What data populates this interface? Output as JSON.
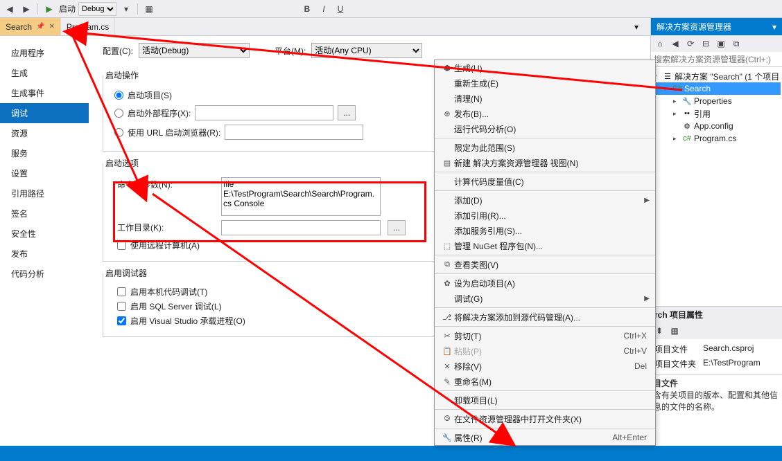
{
  "toolbar": {
    "start_label": "启动",
    "debug_label": "Debug"
  },
  "tabs": {
    "t0": "Search",
    "t1": "Program.cs"
  },
  "side": {
    "items": [
      "应用程序",
      "生成",
      "生成事件",
      "调试",
      "资源",
      "服务",
      "设置",
      "引用路径",
      "签名",
      "安全性",
      "发布",
      "代码分析"
    ],
    "active_index": 3
  },
  "config": {
    "cfg_label": "配置(C):",
    "cfg_val": "活动(Debug)",
    "plat_label": "平台(M):",
    "plat_val": "活动(Any CPU)"
  },
  "section1": {
    "title": "启动操作",
    "r0": "启动项目(S)",
    "r1": "启动外部程序(X):",
    "r2": "使用 URL 启动浏览器(R):"
  },
  "section2": {
    "title": "启动选项",
    "arg_label": "命令行参数(N):",
    "arg_val": "file E:\\TestProgram\\Search\\Search\\Program.cs Console",
    "wd_label": "工作目录(K):",
    "wd_val": "",
    "remote": "使用远程计算机(A)"
  },
  "section3": {
    "title": "启用调试器",
    "c0": "启用本机代码调试(T)",
    "c1": "启用 SQL Server 调试(L)",
    "c2": "启用 Visual Studio 承载进程(O)"
  },
  "menu": {
    "build": "生成(U)",
    "rebuild": "重新生成(E)",
    "clean": "清理(N)",
    "publish": "发布(B)...",
    "analyze": "运行代码分析(O)",
    "scope": "限定为此范围(S)",
    "newview": "新建 解决方案资源管理器 视图(N)",
    "codemetric": "计算代码度量值(C)",
    "add": "添加(D)",
    "addref": "添加引用(R)...",
    "addsvc": "添加服务引用(S)...",
    "nuget": "管理 NuGet 程序包(N)...",
    "classview": "查看类图(V)",
    "startup": "设为启动项目(A)",
    "debug": "调试(G)",
    "scm": "将解决方案添加到源代码管理(A)...",
    "cut": "剪切(T)",
    "paste": "粘贴(P)",
    "remove": "移除(V)",
    "rename": "重命名(M)",
    "unload": "卸载项目(L)",
    "openfolder": "在文件资源管理器中打开文件夹(X)",
    "props": "属性(R)",
    "sc_cut": "Ctrl+X",
    "sc_paste": "Ctrl+V",
    "sc_del": "Del",
    "sc_props": "Alt+Enter"
  },
  "sol": {
    "title": "解决方案资源管理器",
    "search_ph": "搜索解决方案资源管理器(Ctrl+;)",
    "root": "解决方案 \"Search\" (1 个项目",
    "proj": "Search",
    "props": "Properties",
    "refs": "引用",
    "appcfg": "App.config",
    "prog": "Program.cs"
  },
  "prop": {
    "title": "rch 项目属性",
    "r0n": "项目文件",
    "r0v": "Search.csproj",
    "r1n": "项目文件夹",
    "r1v": "E:\\TestProgram",
    "desc_title": "目文件",
    "desc_body": "含有关项目的版本、配置和其他信息的文件的名称。"
  }
}
